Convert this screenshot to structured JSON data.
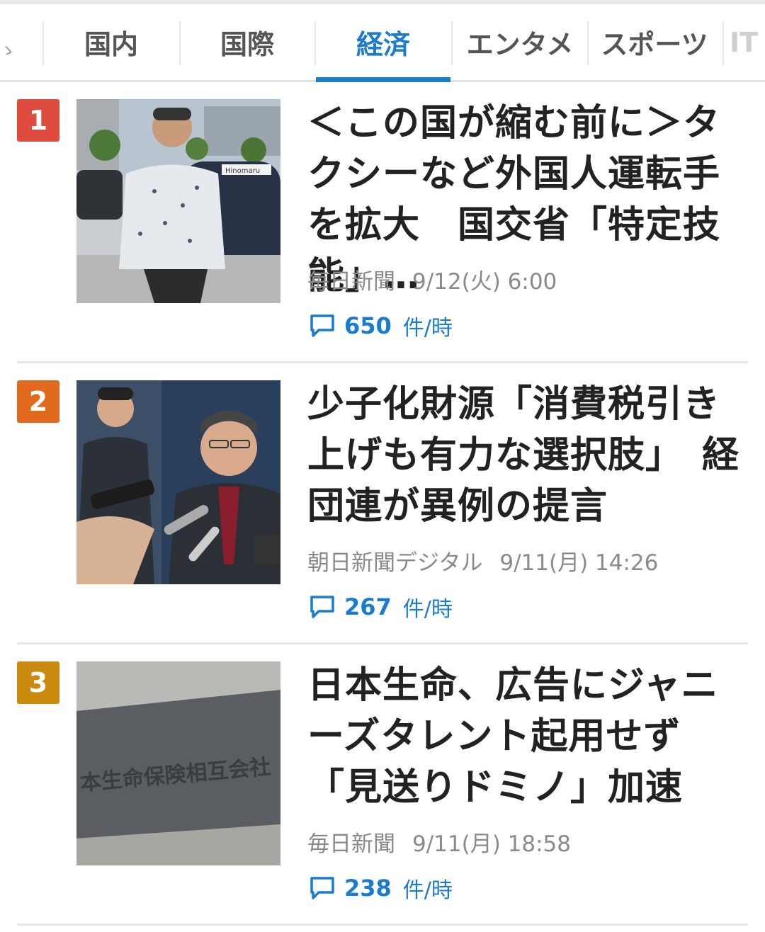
{
  "tabs": [
    {
      "label": "国内",
      "active": false
    },
    {
      "label": "国際",
      "active": false
    },
    {
      "label": "経済",
      "active": true
    },
    {
      "label": "エンタメ",
      "active": false
    },
    {
      "label": "スポーツ",
      "active": false
    },
    {
      "label": "IT",
      "active": false
    }
  ],
  "colors": {
    "accent": "#1a7ccf",
    "rank1": "#e04b3f",
    "rank2": "#e26a1e",
    "rank3": "#c98a0e"
  },
  "articles": [
    {
      "rank": "1",
      "headline": "＜この国が縮む前に＞タクシーなど外国人運転手を拡大　国交省「特定技能」…",
      "source": "毎日新聞",
      "date": "9/12(火) 6:00",
      "comment_count": "650",
      "comment_unit": "件/時",
      "image_icon": "photo-driver-with-taxi",
      "image_text": "Hinomaru"
    },
    {
      "rank": "2",
      "headline": "少子化財源「消費税引き上げも有力な選択肢」　経団連が異例の提言",
      "source": "朝日新聞デジタル",
      "date": "9/11(月) 14:26",
      "comment_count": "267",
      "comment_unit": "件/時",
      "image_icon": "photo-press-interview"
    },
    {
      "rank": "3",
      "headline": "日本生命、広告にジャニーズタレント起用せず　「見送りドミノ」加速",
      "source": "毎日新聞",
      "date": "9/11(月) 18:58",
      "comment_count": "238",
      "comment_unit": "件/時",
      "image_icon": "photo-company-sign",
      "image_text": "本生命保険相互会社"
    }
  ]
}
